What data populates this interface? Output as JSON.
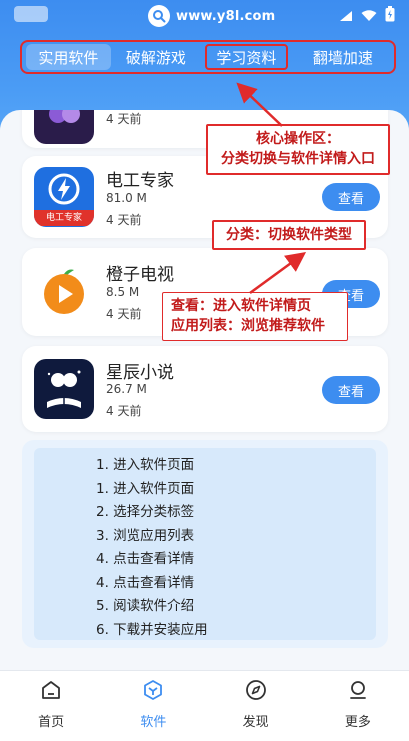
{
  "statusbar": {
    "url": "www.y8l.com",
    "icons": [
      "search-icon",
      "wifi-icon",
      "signal-icon",
      "battery-icon"
    ]
  },
  "tabs": [
    {
      "label": "实用软件",
      "active": true
    },
    {
      "label": "破解游戏",
      "active": false
    },
    {
      "label": "学习资料",
      "active": false
    },
    {
      "label": "翻墙加速",
      "active": false
    }
  ],
  "apps": [
    {
      "name": "",
      "size": "",
      "date": "4 天前"
    },
    {
      "name": "电工专家",
      "size": "81.0 M",
      "date": "4 天前",
      "icon_text": "电工专家",
      "button": "查看"
    },
    {
      "name": "橙子电视",
      "size": "8.5 M",
      "date": "4 天前",
      "button": "查看"
    },
    {
      "name": "星辰小说",
      "size": "26.7 M",
      "date": "4 天前",
      "button": "查看"
    }
  ],
  "callouts": {
    "core": [
      "核心操作区：",
      "分类切换与软件详情入口"
    ],
    "category": "分类：切换软件类型",
    "view": [
      "查看：进入软件详情页",
      "应用列表：浏览推荐软件"
    ]
  },
  "steps": [
    "1. 进入软件页面",
    "1. 进入软件页面",
    "2. 选择分类标签",
    "3. 浏览应用列表",
    "4. 点击查看详情",
    "4. 点击查看详情",
    "5. 阅读软件介绍",
    "6. 下载并安装应用"
  ],
  "nav": [
    {
      "label": "首页",
      "icon": "home-icon",
      "active": false
    },
    {
      "label": "软件",
      "icon": "cube-icon",
      "active": true
    },
    {
      "label": "发现",
      "icon": "compass-icon",
      "active": false
    },
    {
      "label": "更多",
      "icon": "user-icon",
      "active": false
    }
  ],
  "colors": {
    "primary": "#3d8df0",
    "annotation_red": "#e02b2b"
  }
}
